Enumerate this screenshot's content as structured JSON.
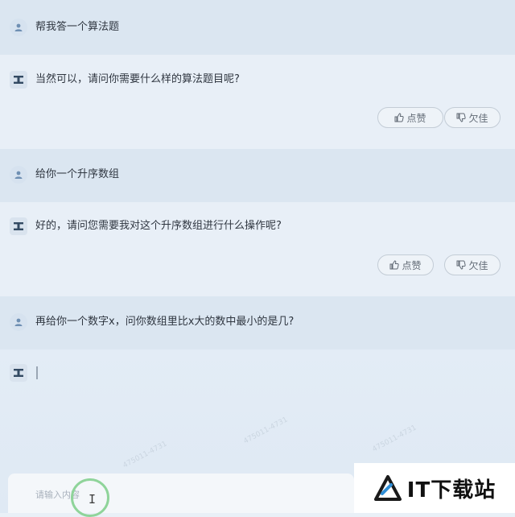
{
  "conversation": [
    {
      "role": "user",
      "text": "帮我答一个算法题"
    },
    {
      "role": "assistant",
      "text": "当然可以，请问你需要什么样的算法题目呢?"
    },
    {
      "role": "user",
      "text": "给你一个升序数组"
    },
    {
      "role": "assistant",
      "text": "好的，请问您需要我对这个升序数组进行什么操作呢?"
    },
    {
      "role": "user",
      "text": "再给你一个数字x，问你数组里比x大的数中最小的是几?"
    },
    {
      "role": "assistant",
      "text": ""
    }
  ],
  "feedback": {
    "like_label": "点赞",
    "dislike_label": "欠佳"
  },
  "input": {
    "placeholder": "请输入内容"
  },
  "watermark_text": "475011-4731",
  "logo": {
    "text": "IT下载站"
  },
  "colors": {
    "accent_green": "#8fd49a",
    "user_row": "#dbe6f1",
    "bot_row": "#e8eff7"
  },
  "icons": {
    "user_avatar": "person-icon",
    "bot_avatar": "bot-logo-icon",
    "like": "thumbs-up-icon",
    "dislike": "thumbs-down-icon"
  }
}
